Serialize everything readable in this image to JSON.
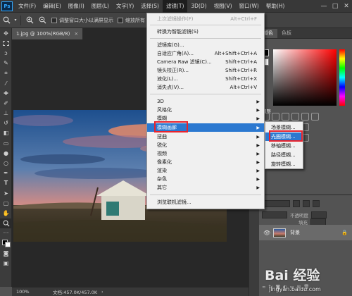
{
  "app": {
    "logo_text": "Ps"
  },
  "menubar": {
    "items": [
      "文件(F)",
      "编辑(E)",
      "图像(I)",
      "图层(L)",
      "文字(Y)",
      "选择(S)",
      "滤镜(T)",
      "3D(D)",
      "视图(V)",
      "窗口(W)",
      "帮助(H)"
    ],
    "active_index": 6
  },
  "window_controls": {
    "minimize": "—",
    "maximize": "□",
    "close": "✕"
  },
  "options_bar": {
    "checkbox_1_label": "调整窗口大小以满屏显示",
    "checkbox_2_label": "缩放所有"
  },
  "document": {
    "tab_title": "1.jpg @ 100%(RGB/8)",
    "tab_close": "×"
  },
  "status_bar": {
    "zoom": "100%",
    "doc_info": "文档:457.0K/457.0K"
  },
  "panels": {
    "top_tabs": [
      "颜色",
      "色板"
    ],
    "adjust_tab": "调整",
    "layer_controls": {
      "opacity_label": "不透明度",
      "fill_label": "填充"
    },
    "layer_name": "背景"
  },
  "filter_menu": {
    "items": [
      {
        "label": "上次滤镜操作(F)",
        "shortcut": "Alt+Ctrl+F",
        "disabled": true
      },
      {
        "label": "转换为智能滤镜(S)",
        "shortcut": ""
      },
      {
        "label": "滤镜库(G)...",
        "shortcut": ""
      },
      {
        "label": "自适应广角(A)...",
        "shortcut": "Alt+Shift+Ctrl+A"
      },
      {
        "label": "Camera Raw 滤镜(C)...",
        "shortcut": "Shift+Ctrl+A"
      },
      {
        "label": "镜头校正(R)...",
        "shortcut": "Shift+Ctrl+R"
      },
      {
        "label": "液化(L)...",
        "shortcut": "Shift+Ctrl+X"
      },
      {
        "label": "消失点(V)...",
        "shortcut": "Alt+Ctrl+V"
      },
      {
        "label": "3D",
        "submenu": true
      },
      {
        "label": "风格化",
        "submenu": true
      },
      {
        "label": "模糊",
        "submenu": true
      },
      {
        "label": "模糊画廊",
        "submenu": true,
        "highlighted": true
      },
      {
        "label": "扭曲",
        "submenu": true
      },
      {
        "label": "锐化",
        "submenu": true
      },
      {
        "label": "视频",
        "submenu": true
      },
      {
        "label": "像素化",
        "submenu": true
      },
      {
        "label": "渲染",
        "submenu": true
      },
      {
        "label": "杂色",
        "submenu": true
      },
      {
        "label": "其它",
        "submenu": true
      },
      {
        "label": "浏览联机滤镜...",
        "shortcut": ""
      }
    ]
  },
  "blur_gallery_submenu": {
    "items": [
      "场景模糊...",
      "光圈模糊...",
      "移轴模糊...",
      "路径模糊...",
      "旋转模糊..."
    ],
    "highlighted_index": 1
  },
  "watermark": {
    "brand": "Bai 经验",
    "url": "jingyan.baidu.com"
  }
}
